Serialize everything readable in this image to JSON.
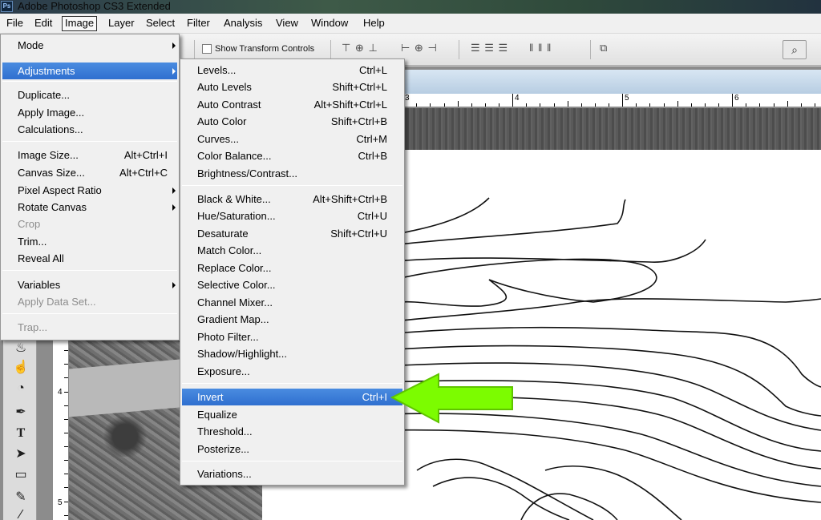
{
  "app": {
    "title": "Adobe Photoshop CS3 Extended",
    "logo": "Ps"
  },
  "menubar": [
    "File",
    "Edit",
    "Image",
    "Layer",
    "Select",
    "Filter",
    "Analysis",
    "View",
    "Window",
    "Help"
  ],
  "optionsbar": {
    "show_transform_controls": "Show Transform Controls",
    "checked": false
  },
  "ruler": {
    "h_labels": [
      "3",
      "4",
      "5",
      "6"
    ],
    "v_labels": [
      "4",
      "5"
    ]
  },
  "image_menu": {
    "items": [
      {
        "label": "Mode",
        "shortcut": "",
        "submenu": true,
        "disabled": false
      },
      {
        "label": "Adjustments",
        "shortcut": "",
        "submenu": true,
        "disabled": false,
        "highlighted": true
      },
      {
        "label": "Duplicate...",
        "shortcut": "",
        "submenu": false,
        "disabled": false
      },
      {
        "label": "Apply Image...",
        "shortcut": "",
        "submenu": false,
        "disabled": false
      },
      {
        "label": "Calculations...",
        "shortcut": "",
        "submenu": false,
        "disabled": false
      },
      {
        "label": "Image Size...",
        "shortcut": "Alt+Ctrl+I",
        "submenu": false,
        "disabled": false
      },
      {
        "label": "Canvas Size...",
        "shortcut": "Alt+Ctrl+C",
        "submenu": false,
        "disabled": false
      },
      {
        "label": "Pixel Aspect Ratio",
        "shortcut": "",
        "submenu": true,
        "disabled": false
      },
      {
        "label": "Rotate Canvas",
        "shortcut": "",
        "submenu": true,
        "disabled": false
      },
      {
        "label": "Crop",
        "shortcut": "",
        "submenu": false,
        "disabled": true
      },
      {
        "label": "Trim...",
        "shortcut": "",
        "submenu": false,
        "disabled": false
      },
      {
        "label": "Reveal All",
        "shortcut": "",
        "submenu": false,
        "disabled": false
      },
      {
        "label": "Variables",
        "shortcut": "",
        "submenu": true,
        "disabled": false
      },
      {
        "label": "Apply Data Set...",
        "shortcut": "",
        "submenu": false,
        "disabled": true
      },
      {
        "label": "Trap...",
        "shortcut": "",
        "submenu": false,
        "disabled": true
      }
    ]
  },
  "adjustments_menu": {
    "items": [
      {
        "label": "Levels...",
        "shortcut": "Ctrl+L"
      },
      {
        "label": "Auto Levels",
        "shortcut": "Shift+Ctrl+L"
      },
      {
        "label": "Auto Contrast",
        "shortcut": "Alt+Shift+Ctrl+L"
      },
      {
        "label": "Auto Color",
        "shortcut": "Shift+Ctrl+B"
      },
      {
        "label": "Curves...",
        "shortcut": "Ctrl+M"
      },
      {
        "label": "Color Balance...",
        "shortcut": "Ctrl+B"
      },
      {
        "label": "Brightness/Contrast...",
        "shortcut": ""
      },
      {
        "label": "Black & White...",
        "shortcut": "Alt+Shift+Ctrl+B"
      },
      {
        "label": "Hue/Saturation...",
        "shortcut": "Ctrl+U"
      },
      {
        "label": "Desaturate",
        "shortcut": "Shift+Ctrl+U"
      },
      {
        "label": "Match Color...",
        "shortcut": ""
      },
      {
        "label": "Replace Color...",
        "shortcut": ""
      },
      {
        "label": "Selective Color...",
        "shortcut": ""
      },
      {
        "label": "Channel Mixer...",
        "shortcut": ""
      },
      {
        "label": "Gradient Map...",
        "shortcut": ""
      },
      {
        "label": "Photo Filter...",
        "shortcut": ""
      },
      {
        "label": "Shadow/Highlight...",
        "shortcut": ""
      },
      {
        "label": "Exposure...",
        "shortcut": ""
      },
      {
        "label": "Invert",
        "shortcut": "Ctrl+I",
        "highlighted": true
      },
      {
        "label": "Equalize",
        "shortcut": ""
      },
      {
        "label": "Threshold...",
        "shortcut": ""
      },
      {
        "label": "Posterize...",
        "shortcut": ""
      },
      {
        "label": "Variations...",
        "shortcut": ""
      }
    ]
  },
  "annotation": {
    "arrow_color": "#7cfc00",
    "points_to": "Invert"
  },
  "colors": {
    "highlight": "#3478d6",
    "menu_bg": "#f0f0f0"
  }
}
